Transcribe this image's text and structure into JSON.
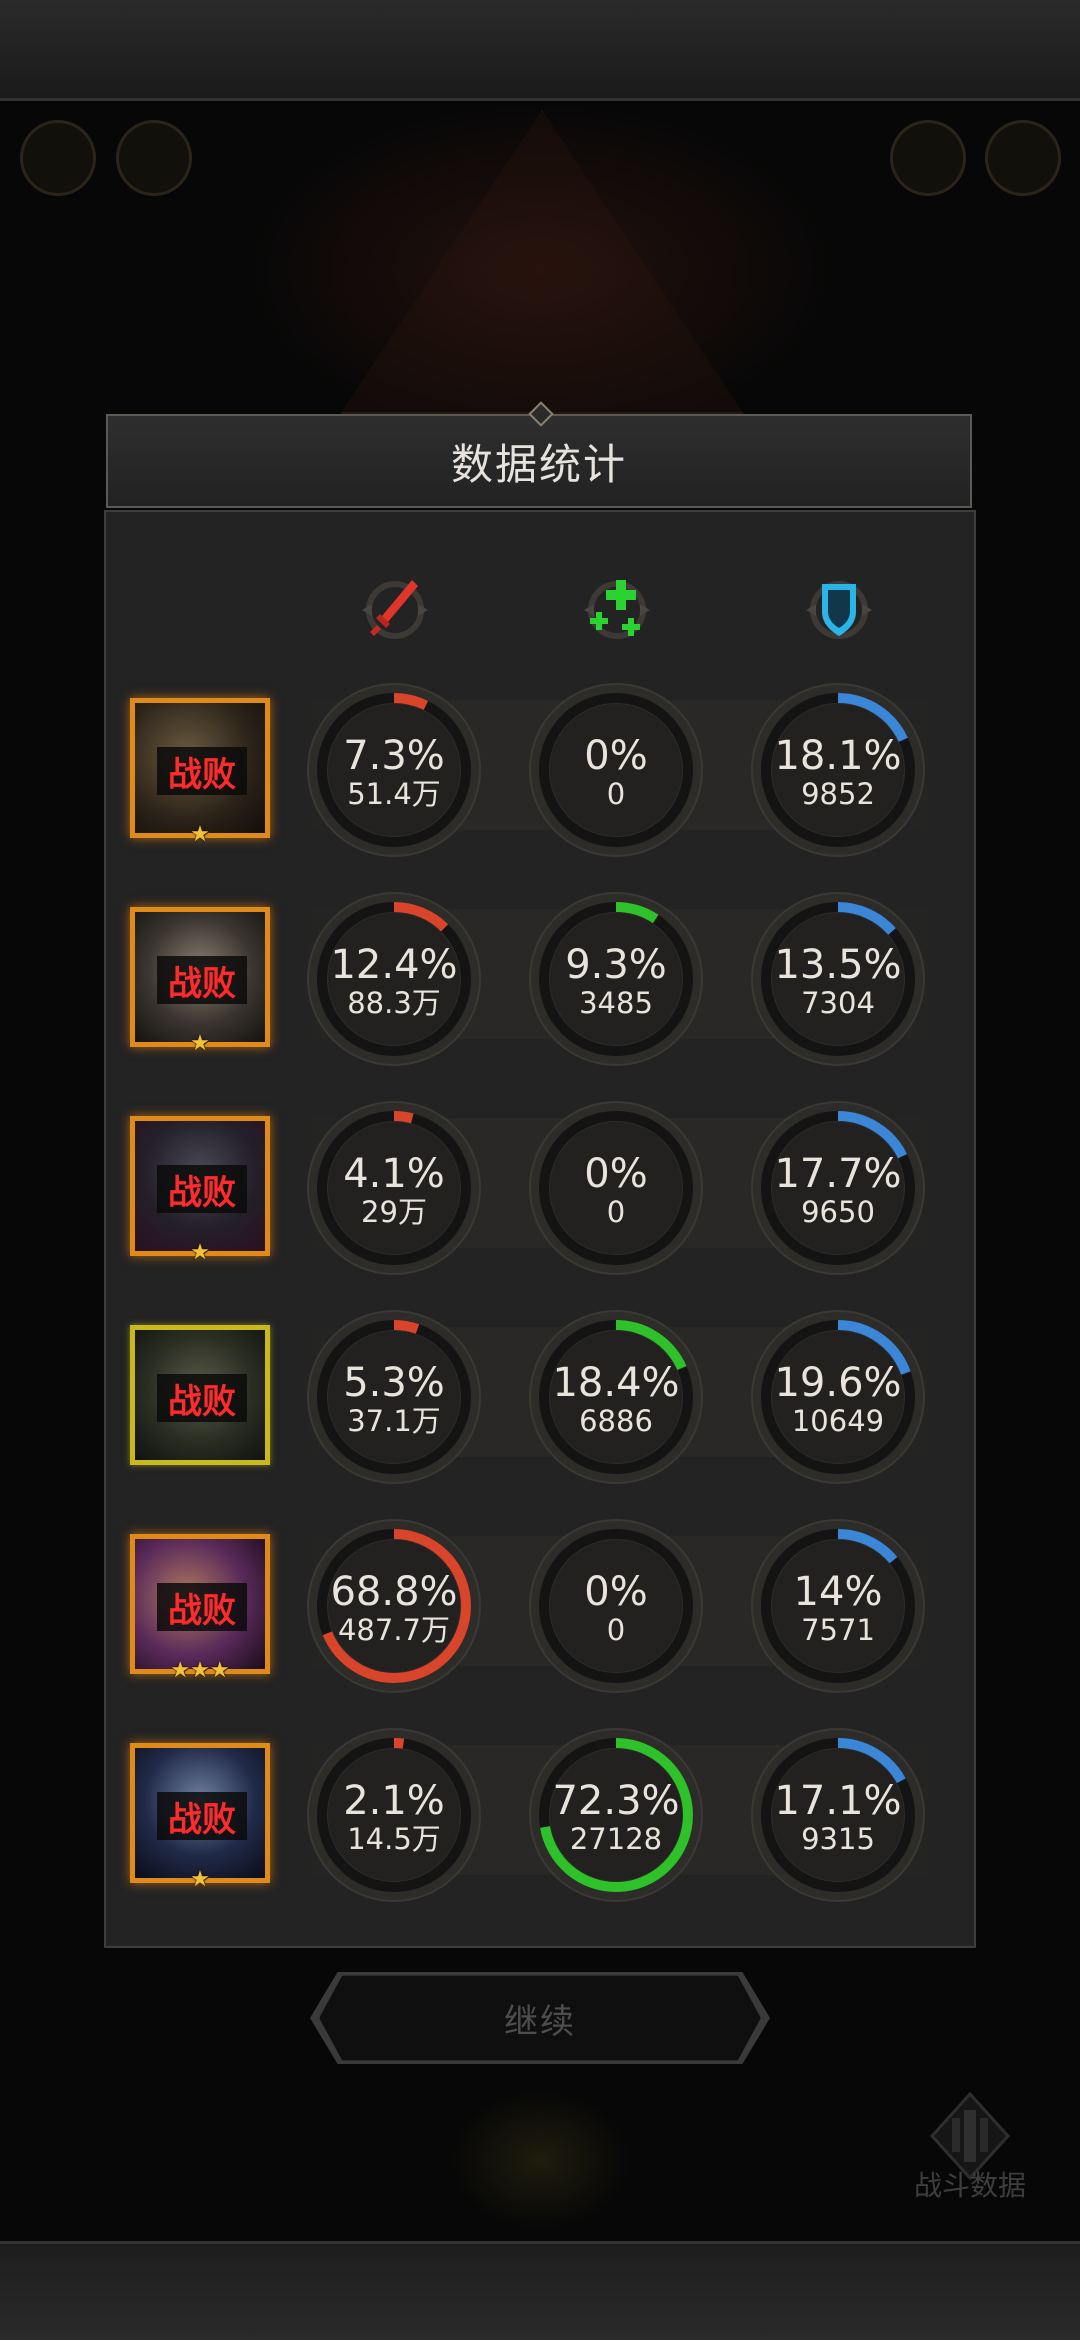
{
  "panel": {
    "title": "数据统计"
  },
  "columns": [
    {
      "icon": "damage-sword-icon",
      "color": "#d9332a"
    },
    {
      "icon": "healing-cross-icon",
      "color": "#29c72f"
    },
    {
      "icon": "defense-shield-icon",
      "color": "#2bb4e6"
    }
  ],
  "colors": {
    "damage": "#d9452a",
    "heal": "#2fc12a",
    "tank": "#3b86d6",
    "defeat_text": "#ff2b2b",
    "star": "#f3c23b"
  },
  "rows": [
    {
      "status": "战败",
      "stars": 1,
      "damage": {
        "pct": "7.3%",
        "value": "51.4万",
        "fraction": 0.073
      },
      "heal": {
        "pct": "0%",
        "value": "0",
        "fraction": 0
      },
      "tank": {
        "pct": "18.1%",
        "value": "9852",
        "fraction": 0.181
      }
    },
    {
      "status": "战败",
      "stars": 1,
      "damage": {
        "pct": "12.4%",
        "value": "88.3万",
        "fraction": 0.124
      },
      "heal": {
        "pct": "9.3%",
        "value": "3485",
        "fraction": 0.093
      },
      "tank": {
        "pct": "13.5%",
        "value": "7304",
        "fraction": 0.135
      }
    },
    {
      "status": "战败",
      "stars": 1,
      "damage": {
        "pct": "4.1%",
        "value": "29万",
        "fraction": 0.041
      },
      "heal": {
        "pct": "0%",
        "value": "0",
        "fraction": 0
      },
      "tank": {
        "pct": "17.7%",
        "value": "9650",
        "fraction": 0.177
      }
    },
    {
      "status": "战败",
      "stars": 0,
      "damage": {
        "pct": "5.3%",
        "value": "37.1万",
        "fraction": 0.053
      },
      "heal": {
        "pct": "18.4%",
        "value": "6886",
        "fraction": 0.184
      },
      "tank": {
        "pct": "19.6%",
        "value": "10649",
        "fraction": 0.196
      }
    },
    {
      "status": "战败",
      "stars": 3,
      "damage": {
        "pct": "68.8%",
        "value": "487.7万",
        "fraction": 0.688
      },
      "heal": {
        "pct": "0%",
        "value": "0",
        "fraction": 0
      },
      "tank": {
        "pct": "14%",
        "value": "7571",
        "fraction": 0.14
      }
    },
    {
      "status": "战败",
      "stars": 1,
      "damage": {
        "pct": "2.1%",
        "value": "14.5万",
        "fraction": 0.021
      },
      "heal": {
        "pct": "72.3%",
        "value": "27128",
        "fraction": 0.723
      },
      "tank": {
        "pct": "17.1%",
        "value": "9315",
        "fraction": 0.171
      }
    }
  ],
  "continue_button": {
    "label": "继续"
  },
  "battle_data_button": {
    "label": "战斗数据",
    "icon": "battle-data-icon"
  }
}
